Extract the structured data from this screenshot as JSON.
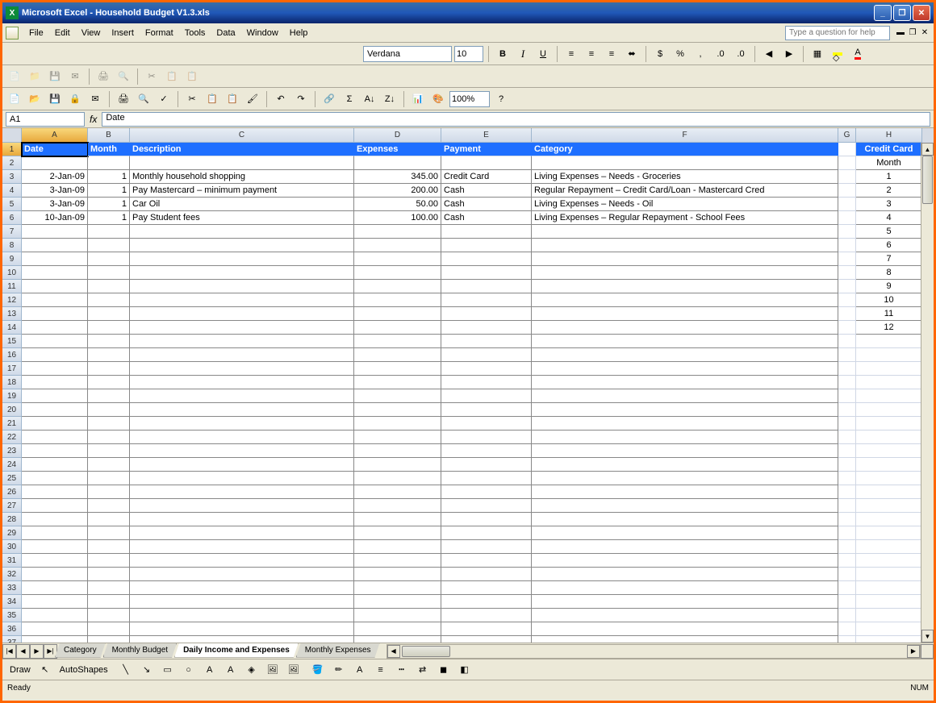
{
  "titlebar": {
    "app": "Microsoft Excel",
    "file": "Household Budget V1.3.xls"
  },
  "menu": {
    "items": [
      "File",
      "Edit",
      "View",
      "Insert",
      "Format",
      "Tools",
      "Data",
      "Window",
      "Help"
    ],
    "help_placeholder": "Type a question for help"
  },
  "formatting": {
    "font": "Verdana",
    "size": "10",
    "zoom": "100%"
  },
  "namebox": {
    "ref": "A1",
    "formula": "Date"
  },
  "columns": [
    "A",
    "B",
    "C",
    "D",
    "E",
    "F",
    "G",
    "H"
  ],
  "main_headers": {
    "A": "Date",
    "B": "Month",
    "C": "Description",
    "D": "Expenses",
    "E": "Payment",
    "F": "Category"
  },
  "side_header": "Credit Card",
  "side_subheader": "Month",
  "data_rows": [
    {
      "date": "2-Jan-09",
      "month": "1",
      "desc": "Monthly household shopping",
      "exp": "345.00",
      "pay": "Credit Card",
      "cat": "Living Expenses – Needs - Groceries"
    },
    {
      "date": "3-Jan-09",
      "month": "1",
      "desc": "Pay Mastercard – minimum payment",
      "exp": "200.00",
      "pay": "Cash",
      "cat": "Regular Repayment – Credit Card/Loan - Mastercard Cred"
    },
    {
      "date": "3-Jan-09",
      "month": "1",
      "desc": "Car Oil",
      "exp": "50.00",
      "pay": "Cash",
      "cat": "Living Expenses – Needs - Oil"
    },
    {
      "date": "10-Jan-09",
      "month": "1",
      "desc": "Pay Student fees",
      "exp": "100.00",
      "pay": "Cash",
      "cat": "Living Expenses – Regular Repayment - School Fees"
    }
  ],
  "side_values": [
    "1",
    "2",
    "3",
    "4",
    "5",
    "6",
    "7",
    "8",
    "9",
    "10",
    "11",
    "12"
  ],
  "total_rows": 37,
  "sheet_tabs": [
    "Category",
    "Monthly Budget",
    "Daily Income and Expenses",
    "Monthly Expenses"
  ],
  "active_tab": 2,
  "draw": {
    "label": "Draw",
    "autoshapes": "AutoShapes"
  },
  "status": {
    "left": "Ready",
    "right": "NUM"
  }
}
